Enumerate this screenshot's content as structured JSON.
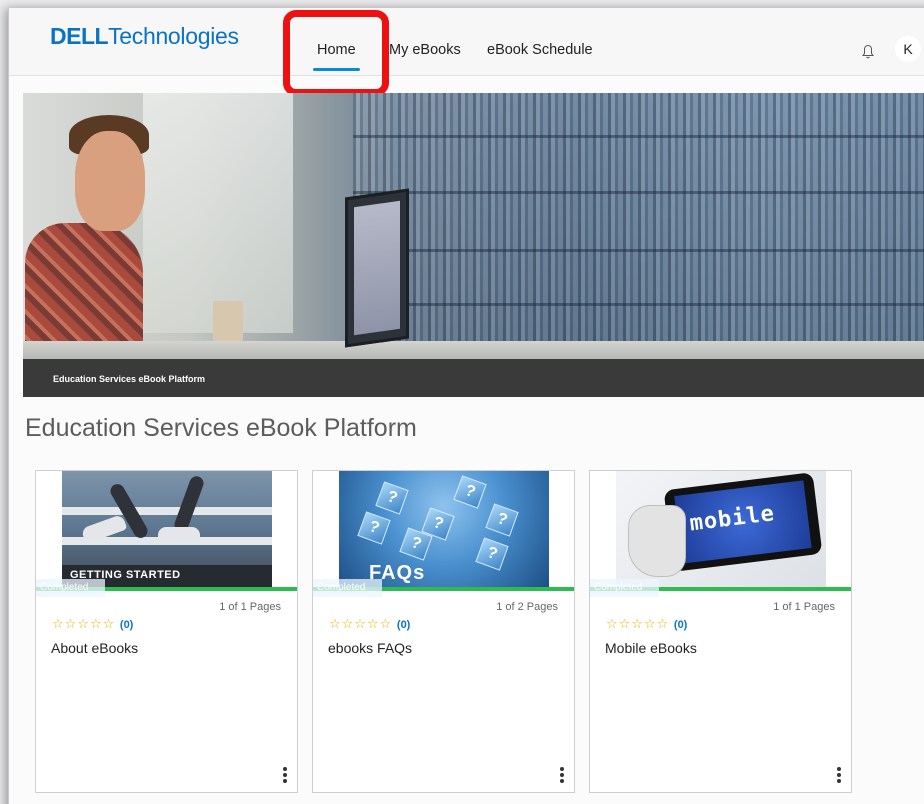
{
  "header": {
    "logo_brand": "DELL",
    "logo_suffix": "Technologies",
    "nav": [
      {
        "label": "Home",
        "active": true
      },
      {
        "label": "My eBooks",
        "active": false
      },
      {
        "label": "eBook Schedule",
        "active": false
      }
    ],
    "avatar_initial": "K",
    "icons": [
      "bell-icon"
    ]
  },
  "banner": {
    "caption": "Education Services eBook Platform"
  },
  "main": {
    "title": "Education Services eBook Platform",
    "cards": [
      {
        "title": "About eBooks",
        "pages": "1 of 1 Pages",
        "rating_count": "(0)",
        "status": "Completed",
        "thumb_label": "GETTING STARTED"
      },
      {
        "title": "ebooks FAQs",
        "pages": "1 of 2 Pages",
        "rating_count": "(0)",
        "status": "Completed",
        "thumb_label": "FAQs"
      },
      {
        "title": "Mobile eBooks",
        "pages": "1 of 1 Pages",
        "rating_count": "(0)",
        "status": "Completed",
        "thumb_label": "mobile"
      }
    ],
    "stars": "☆☆☆☆☆"
  },
  "colors": {
    "accent": "#0a73c7",
    "highlight": "#ee1111",
    "progress": "#2dbd4f"
  }
}
